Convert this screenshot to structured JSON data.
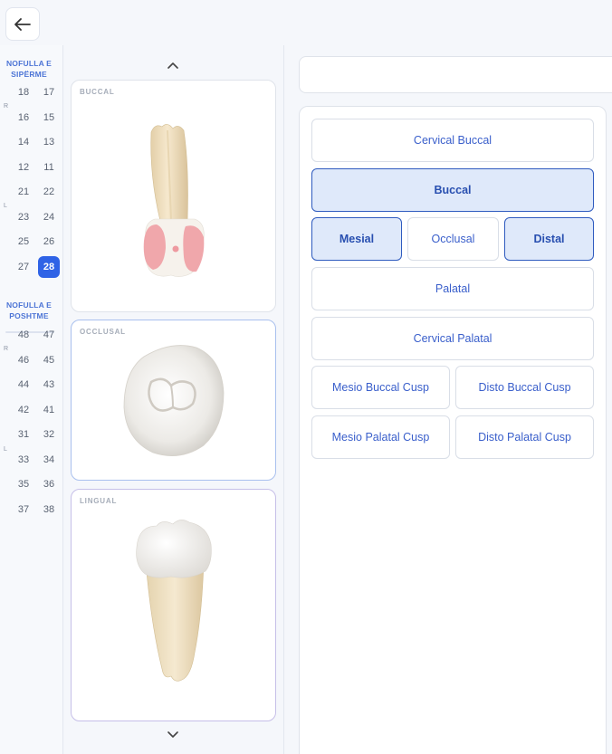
{
  "back_button": {
    "icon": "arrow-left-icon"
  },
  "rail": {
    "upper_title": "NOFULLA E SIPËRME",
    "lower_title": "NOFULLA E POSHTME",
    "side_right": "R",
    "side_left": "L",
    "upper_rows": [
      [
        "18",
        "17"
      ],
      [
        "16",
        "15"
      ],
      [
        "14",
        "13"
      ],
      [
        "12",
        "11"
      ],
      [
        "21",
        "22"
      ],
      [
        "23",
        "24"
      ],
      [
        "25",
        "26"
      ],
      [
        "27",
        "28"
      ]
    ],
    "lower_rows": [
      [
        "48",
        "47"
      ],
      [
        "46",
        "45"
      ],
      [
        "44",
        "43"
      ],
      [
        "42",
        "41"
      ],
      [
        "31",
        "32"
      ],
      [
        "33",
        "34"
      ],
      [
        "35",
        "36"
      ],
      [
        "37",
        "38"
      ]
    ],
    "selected_tooth": "28"
  },
  "views": {
    "up_icon": "chevron-up-icon",
    "down_icon": "chevron-down-icon",
    "buccal_label": "BUCCAL",
    "occlusal_label": "OCCLUSAL",
    "lingual_label": "LINGUAL"
  },
  "search": {
    "value": ""
  },
  "surfaces": {
    "cervical_buccal": "Cervical Buccal",
    "buccal": "Buccal",
    "mesial": "Mesial",
    "occlusal": "Occlusal",
    "distal": "Distal",
    "palatal": "Palatal",
    "cervical_palatal": "Cervical Palatal",
    "mesio_buccal_cusp": "Mesio Buccal Cusp",
    "disto_buccal_cusp": "Disto Buccal Cusp",
    "mesio_palatal_cusp": "Mesio Palatal Cusp",
    "disto_palatal_cusp": "Disto Palatal Cusp",
    "selected": [
      "buccal",
      "mesial",
      "distal"
    ]
  },
  "colors": {
    "accent": "#2f63e6",
    "selected_fill": "#dfe9fa",
    "highlight": "#ee9aa0"
  }
}
